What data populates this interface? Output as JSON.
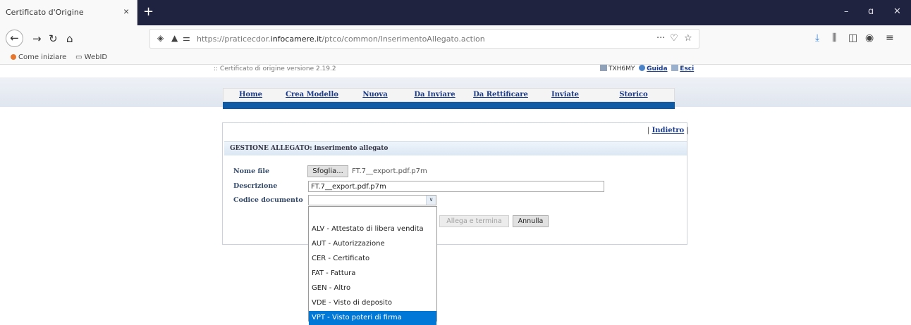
{
  "browser": {
    "tab_title": "Certificato d'Origine",
    "tab_close": "×",
    "new_tab": "+",
    "url_prefix": "https://praticecdor.",
    "url_domain": "infocamere.it",
    "url_path": "/ptco/common/InserimentoAllegato.action",
    "page_actions": "···",
    "window_minimize": "–",
    "window_restore": "ɑ",
    "window_close": "✕"
  },
  "bookmarks": [
    {
      "label": "Come iniziare"
    },
    {
      "label": "WebID"
    }
  ],
  "header": {
    "version": ":: Certificato di origine versione 2.19.2",
    "user": "TXH6MY",
    "guida": "Guida",
    "esci": "Esci"
  },
  "menu": {
    "items": [
      {
        "label": "Home"
      },
      {
        "label": "Crea Modello"
      },
      {
        "label": "Nuova"
      },
      {
        "label": "Da Inviare"
      },
      {
        "label": "Da Rettificare"
      },
      {
        "label": "Inviate"
      },
      {
        "label": "Storico"
      }
    ]
  },
  "form": {
    "back_link": "Indietro",
    "section_title": "GESTIONE ALLEGATO: inserimento allegato",
    "nome_file_label": "Nome file",
    "browse_label": "Sfoglia...",
    "selected_file": "FT.7__export.pdf.p7m",
    "descrizione_label": "Descrizione",
    "descrizione_value": "FT.7__export.pdf.p7m",
    "codice_label": "Codice documento",
    "codice_value": "",
    "allega_button": "Allega e termina",
    "annulla_button": "Annulla"
  },
  "dropdown": {
    "options": [
      {
        "label": "ALV - Attestato di libera vendita"
      },
      {
        "label": "AUT - Autorizzazione"
      },
      {
        "label": "CER - Certificato"
      },
      {
        "label": "FAT - Fattura"
      },
      {
        "label": "GEN - Altro"
      },
      {
        "label": "VDE - Visto di deposito"
      },
      {
        "label": "VPT - Visto poteri di firma"
      }
    ],
    "highlighted": "VPT - Visto poteri di firma"
  },
  "colors": {
    "titlebar": "#202340",
    "menu_link": "#1a3a8a",
    "blue_bar": "#0d5aa7",
    "selection": "#0078d7"
  }
}
